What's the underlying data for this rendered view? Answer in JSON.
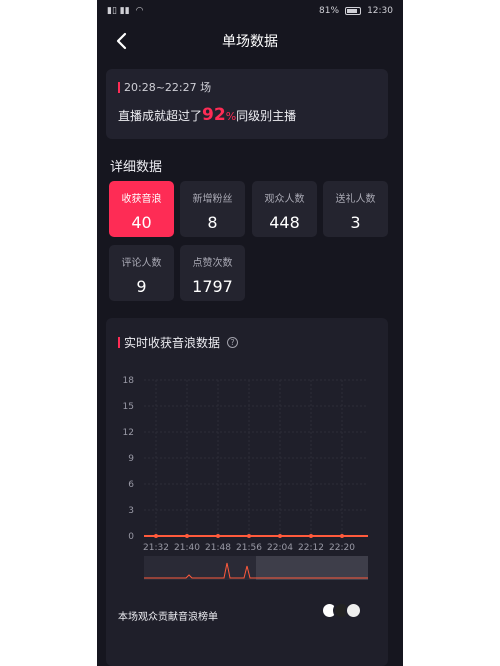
{
  "status_bar": {
    "battery": "81%",
    "time": "12:30"
  },
  "header": {
    "title": "单场数据"
  },
  "summary": {
    "time_range": "20:28~22:27 场",
    "text_before": "直播成就超过了",
    "percent": "92",
    "percent_sign": "%",
    "text_after": "同级别主播"
  },
  "details": {
    "title": "详细数据",
    "stats": [
      {
        "label": "收获音浪",
        "value": "40",
        "active": true
      },
      {
        "label": "新增粉丝",
        "value": "8"
      },
      {
        "label": "观众人数",
        "value": "448"
      },
      {
        "label": "送礼人数",
        "value": "3"
      },
      {
        "label": "评论人数",
        "value": "9"
      },
      {
        "label": "点赞次数",
        "value": "1797"
      }
    ]
  },
  "realtime": {
    "title": "实时收获音浪数据",
    "help": "?"
  },
  "ranking": {
    "title": "本场观众贡献音浪榜单"
  },
  "colors": {
    "accent": "#fe2c55",
    "line": "#ff5a3c",
    "background": "#16161f",
    "card": "#22222e"
  },
  "chart_data": {
    "type": "line",
    "x": [
      "21:32",
      "21:40",
      "21:48",
      "21:56",
      "22:04",
      "22:12",
      "22:20"
    ],
    "y_ticks": [
      0,
      3,
      6,
      9,
      12,
      15,
      18
    ],
    "ylim": [
      0,
      18
    ],
    "series": [
      {
        "values": [
          0,
          0,
          0,
          0,
          0,
          0,
          0
        ]
      }
    ],
    "grid": true
  }
}
